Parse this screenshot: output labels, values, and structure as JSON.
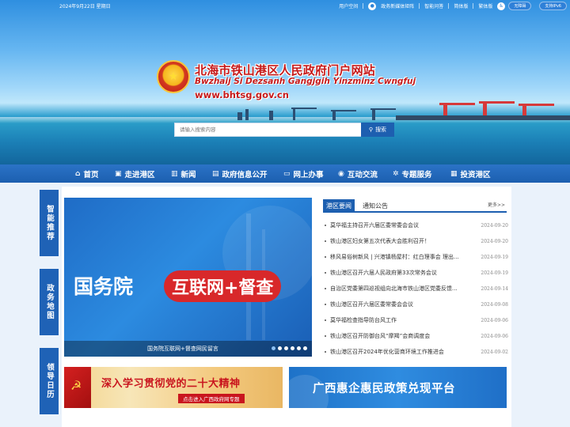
{
  "topbar": {
    "date": "2024年9月22日 星期日",
    "links": [
      "用户空间",
      "政务新媒体矩阵",
      "智能问答",
      "简体版",
      "繁体版"
    ],
    "accessible_label": "无障碍",
    "ipv6_label": "支持IPv6"
  },
  "header": {
    "title": "北海市铁山港区人民政府门户网站",
    "subtitle": "Bwzhaij Si Dezsanh Gangjgih Yinzminz Cwngfuj",
    "url": "www.bhtsg.gov.cn"
  },
  "search": {
    "placeholder": "请输入搜索内容",
    "button": "搜索"
  },
  "nav": [
    {
      "label": "首页",
      "icon": "home-icon"
    },
    {
      "label": "走进港区",
      "icon": "image-icon"
    },
    {
      "label": "新闻",
      "icon": "chart-icon"
    },
    {
      "label": "政府信息公开",
      "icon": "document-icon"
    },
    {
      "label": "网上办事",
      "icon": "monitor-icon"
    },
    {
      "label": "互动交流",
      "icon": "eye-icon"
    },
    {
      "label": "专题服务",
      "icon": "gear-icon"
    },
    {
      "label": "投资港区",
      "icon": "building-icon"
    }
  ],
  "side_tabs": [
    "智能推荐",
    "政务地图",
    "领导日历"
  ],
  "carousel": {
    "title_part1": "国务院",
    "title_part2": "互联网+督查",
    "caption": "国务院互联网+督查网民留言",
    "slide_count": 6,
    "active_index": 0
  },
  "news": {
    "tabs": [
      "港区要闻",
      "通知公告"
    ],
    "more": "更多>>",
    "items": [
      {
        "title": "莫华福主持召开六届区委常委会会议",
        "date": "2024-09-20"
      },
      {
        "title": "铁山港区妇女第五次代表大会胜利召开！",
        "date": "2024-09-20"
      },
      {
        "title": "移风易俗树新风 | 兴港镇杨屋村：红白理事会 理出...",
        "date": "2024-09-19"
      },
      {
        "title": "铁山港区召开六届人民政府第33次常务会议",
        "date": "2024-09-19"
      },
      {
        "title": "自治区党委第四巡视组向北海市铁山港区党委反馈...",
        "date": "2024-09-14"
      },
      {
        "title": "铁山港区召开六届区委常委会会议",
        "date": "2024-09-08"
      },
      {
        "title": "莫华福检查指导防台风工作",
        "date": "2024-09-06"
      },
      {
        "title": "铁山港区召开防御台风“摩羯”会商调度会",
        "date": "2024-09-06"
      },
      {
        "title": "铁山港区召开2024年优化营商环境工作推进会",
        "date": "2024-09-02"
      }
    ]
  },
  "banners": {
    "party_text": "深入学习贯彻党的二十大精神",
    "party_sub": "点击进入广西政府网专题",
    "policy_text": "广西惠企惠民政策兑现平台"
  },
  "colors": {
    "nav_blue": "#1c5fb0",
    "title_red": "#c61a1a",
    "accent_red": "#d8282a"
  }
}
